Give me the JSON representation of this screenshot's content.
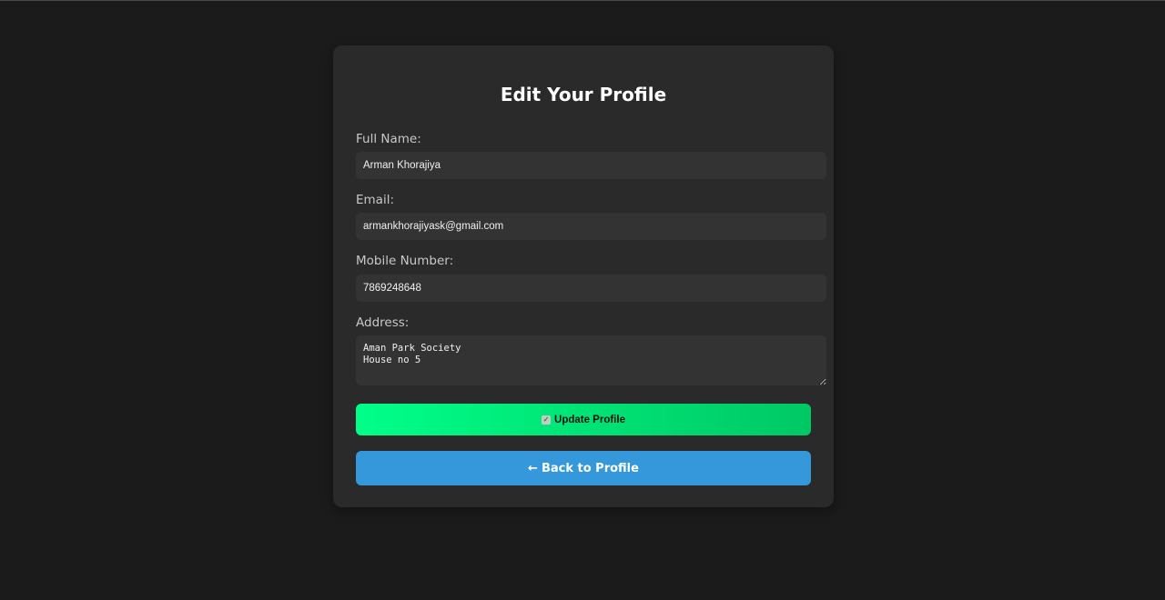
{
  "page": {
    "title": "Edit Your Profile"
  },
  "form": {
    "full_name": {
      "label": "Full Name:",
      "value": "Arman Khorajiya"
    },
    "email": {
      "label": "Email:",
      "value": "armankhorajiyask@gmail.com"
    },
    "mobile": {
      "label": "Mobile Number:",
      "value": "7869248648"
    },
    "address": {
      "label": "Address:",
      "value": "Aman Park Society\nHouse no 5"
    }
  },
  "buttons": {
    "update": {
      "icon": "check-icon",
      "label": "Update Profile"
    },
    "back": {
      "icon": "arrow-left-icon",
      "arrow": "←",
      "label": "Back to Profile"
    }
  },
  "colors": {
    "background": "#1b1b1b",
    "card": "#2a2a2a",
    "input": "#333333",
    "update_gradient_start": "#00ff88",
    "update_gradient_end": "#00c864",
    "back_button": "#3498db"
  }
}
